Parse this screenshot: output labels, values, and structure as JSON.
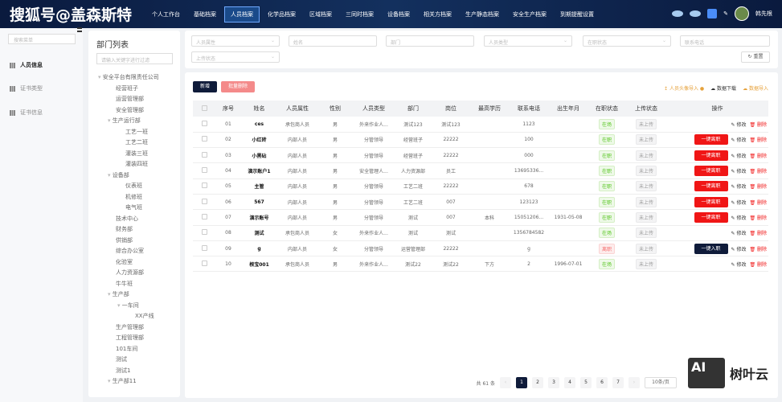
{
  "header": {
    "watermark": "搜狐号@盖森斯特",
    "nav": [
      "个人工作台",
      "基础档案",
      "人员档案",
      "化学品档案",
      "区域档案",
      "三同时档案",
      "设备档案",
      "相关方档案",
      "生产静态档案",
      "安全生产档案",
      "到期提醒设置"
    ],
    "active_nav": 2,
    "username": "韩先根"
  },
  "sidebar": {
    "search_placeholder": "搜索菜单",
    "items": [
      {
        "label": "人员信息",
        "active": true
      },
      {
        "label": "证书类型"
      },
      {
        "label": "证书信息"
      }
    ]
  },
  "dept": {
    "title": "部门列表",
    "filter_placeholder": "请输入关键字进行过滤",
    "tree": [
      {
        "label": "安全平台有限责任公司",
        "level": 0,
        "expand": true
      },
      {
        "label": "经营班子",
        "level": 1
      },
      {
        "label": "运营管理部",
        "level": 1
      },
      {
        "label": "安全管理部",
        "level": 1
      },
      {
        "label": "生产运行部",
        "level": 1,
        "expand": true
      },
      {
        "label": "工艺一班",
        "level": 2
      },
      {
        "label": "工艺二班",
        "level": 2
      },
      {
        "label": "灌装三班",
        "level": 2
      },
      {
        "label": "灌装四班",
        "level": 2
      },
      {
        "label": "设备部",
        "level": 1,
        "expand": true
      },
      {
        "label": "仪表班",
        "level": 2
      },
      {
        "label": "机修班",
        "level": 2
      },
      {
        "label": "电气班",
        "level": 2
      },
      {
        "label": "技术中心",
        "level": 1
      },
      {
        "label": "财务部",
        "level": 1
      },
      {
        "label": "供销部",
        "level": 1
      },
      {
        "label": "综合办公室",
        "level": 1
      },
      {
        "label": "化验室",
        "level": 1
      },
      {
        "label": "人力资源部",
        "level": 1
      },
      {
        "label": "牛牛班",
        "level": 1
      },
      {
        "label": "生产部",
        "level": 1,
        "expand": true
      },
      {
        "label": "一车间",
        "level": 2,
        "expand": true
      },
      {
        "label": "XX产线",
        "level": 3
      },
      {
        "label": "生产管理部",
        "level": 1
      },
      {
        "label": "工程管理部",
        "level": 1
      },
      {
        "label": "101车间",
        "level": 1
      },
      {
        "label": "测试",
        "level": 1
      },
      {
        "label": "测试1",
        "level": 1
      },
      {
        "label": "生产部11",
        "level": 1,
        "expand": true
      }
    ]
  },
  "filters": {
    "person_attr": "人员属性",
    "name": "姓名",
    "dept": "部门",
    "person_type": "人员类型",
    "status": "在职状态",
    "phone": "联系电话",
    "upload": "上传状态",
    "reset": "重置"
  },
  "toolbar": {
    "add": "新增",
    "batch_delete": "批量删除",
    "avatar_import": "人员头像导入",
    "data_download": "数据下载",
    "data_import": "数据导入"
  },
  "table": {
    "headers": [
      "",
      "序号",
      "姓名",
      "人员属性",
      "性别",
      "人员类型",
      "部门",
      "岗位",
      "最高学历",
      "联系电话",
      "出生年月",
      "在职状态",
      "上传状态",
      "操作"
    ],
    "rows": [
      [
        "01",
        "ces",
        "承包商人员",
        "男",
        "外来作业人...",
        "测试123",
        "测试123",
        "",
        "1123",
        "",
        "在场",
        "未上传",
        ""
      ],
      [
        "02",
        "小红砖",
        "内部人员",
        "男",
        "分管领导",
        "经营班子",
        "22222",
        "",
        "100",
        "",
        "在职",
        "未上传",
        "一键离职"
      ],
      [
        "03",
        "小黑砧",
        "内部人员",
        "男",
        "分管领导",
        "经营班子",
        "22222",
        "",
        "000",
        "",
        "在职",
        "未上传",
        "一键离职"
      ],
      [
        "04",
        "演示账户1",
        "内部人员",
        "男",
        "安全管理人...",
        "人力资源部",
        "员工",
        "",
        "13695336...",
        "",
        "在职",
        "未上传",
        "一键离职"
      ],
      [
        "05",
        "主管",
        "内部人员",
        "男",
        "分管领导",
        "工艺二班",
        "22222",
        "",
        "678",
        "",
        "在职",
        "未上传",
        "一键离职"
      ],
      [
        "06",
        "567",
        "内部人员",
        "男",
        "分管领导",
        "工艺二班",
        "007",
        "",
        "123123",
        "",
        "在职",
        "未上传",
        "一键离职"
      ],
      [
        "07",
        "演示账号",
        "内部人员",
        "男",
        "分管领导",
        "测试",
        "007",
        "本科",
        "15051206...",
        "1931-05-08",
        "在职",
        "未上传",
        "一键离职"
      ],
      [
        "08",
        "测试",
        "承包商人员",
        "女",
        "外来作业人...",
        "测试",
        "测试",
        "",
        "1356784582",
        "",
        "在场",
        "未上传",
        ""
      ],
      [
        "09",
        "g",
        "内部人员",
        "女",
        "分管领导",
        "运营管理部",
        "22222",
        "",
        "g",
        "",
        "离职",
        "未上传",
        "一键入职"
      ],
      [
        "10",
        "根宝001",
        "承包商人员",
        "男",
        "外来作业人...",
        "测试22",
        "测试22",
        "下方",
        "2",
        "1996-07-01",
        "在场",
        "未上传",
        ""
      ]
    ],
    "edit": "修改",
    "delete": "删除"
  },
  "pagination": {
    "total": "共 61 条",
    "pages": [
      "1",
      "2",
      "3",
      "4",
      "5",
      "6",
      "7"
    ],
    "current": "1",
    "size": "10条/页"
  },
  "watermark2": {
    "box": "AI",
    "text": "树叶云"
  }
}
